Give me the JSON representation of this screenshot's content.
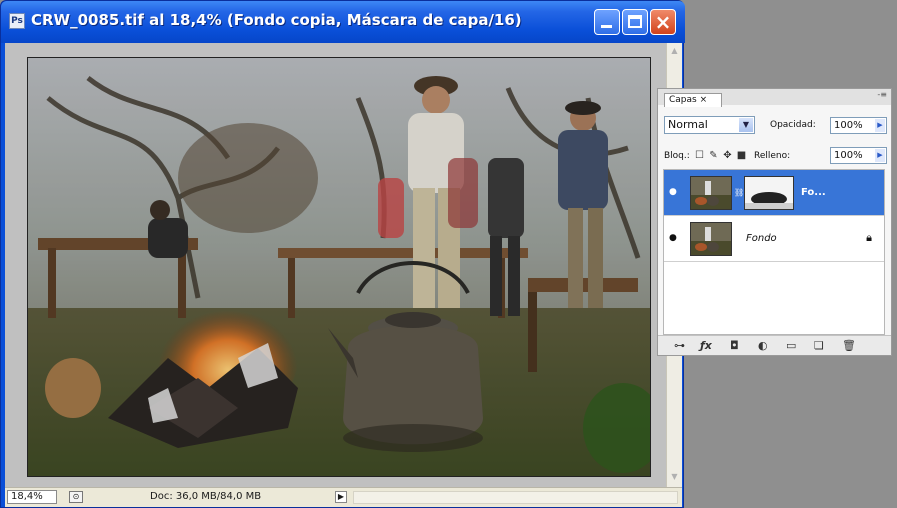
{
  "window": {
    "title": "CRW_0085.tif al 18,4% (Fondo copia, Máscara de capa/16)",
    "icon": "photoshop-doc-icon",
    "controls": {
      "minimize": "minimize-icon",
      "maximize": "maximize-icon",
      "close": "×"
    }
  },
  "status_bar": {
    "zoom": "18,4%",
    "doc_info": "Doc: 36,0 MB/84,0 MB",
    "arrow": "▶"
  },
  "layers_panel": {
    "tab_label": "Capas ×",
    "blend_mode": "Normal",
    "opacity_label": "Opacidad:",
    "opacity_value": "100%",
    "lock_label": "Bloq.:",
    "fill_label": "Relleno:",
    "fill_value": "100%",
    "layers": [
      {
        "name": "Fo...",
        "selected": true,
        "has_mask": true
      },
      {
        "name": "Fondo",
        "selected": false,
        "locked": true
      }
    ],
    "footer_icons": [
      "link-layers-icon",
      "fx-icon",
      "add-mask-icon",
      "adjustment-layer-icon",
      "new-group-icon",
      "new-layer-icon",
      "trash-icon"
    ]
  },
  "colors": {
    "titlebar": "#0a4fd8",
    "selected_layer": "#3875d7",
    "close_button": "#d2421c"
  }
}
